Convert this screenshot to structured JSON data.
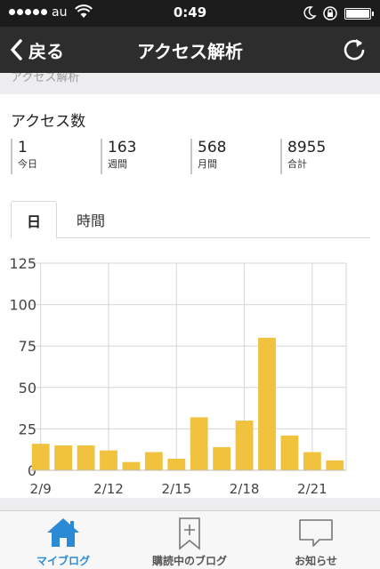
{
  "status_bar": {
    "carrier": "au",
    "time": "0:49"
  },
  "nav": {
    "back_label": "戻る",
    "title": "アクセス解析"
  },
  "section_label": "アクセス解析",
  "access": {
    "title": "アクセス数",
    "stats": [
      {
        "value": "1",
        "label": "今日"
      },
      {
        "value": "163",
        "label": "週間"
      },
      {
        "value": "568",
        "label": "月間"
      },
      {
        "value": "8955",
        "label": "合計"
      }
    ]
  },
  "tabs": [
    {
      "label": "日",
      "active": true
    },
    {
      "label": "時間",
      "active": false
    }
  ],
  "chart_data": {
    "type": "bar",
    "categories": [
      "2/9",
      "2/10",
      "2/11",
      "2/12",
      "2/13",
      "2/14",
      "2/15",
      "2/16",
      "2/17",
      "2/18",
      "2/19",
      "2/20",
      "2/21",
      "2/22"
    ],
    "values": [
      16,
      15,
      15,
      12,
      5,
      11,
      7,
      32,
      14,
      30,
      80,
      21,
      11,
      6
    ],
    "x_tick_labels": [
      "2/9",
      "2/12",
      "2/15",
      "2/18",
      "2/21"
    ],
    "y_tick_labels": [
      "0",
      "25",
      "50",
      "75",
      "100",
      "125"
    ],
    "ylim": [
      0,
      125
    ],
    "bar_color": "#f0c23e",
    "grid": true
  },
  "tab_bar": {
    "items": [
      {
        "label": "マイブログ",
        "icon": "home-icon",
        "active": true
      },
      {
        "label": "購読中のブログ",
        "icon": "bookmark-icon",
        "active": false
      },
      {
        "label": "お知らせ",
        "icon": "speech-bubble-icon",
        "active": false
      }
    ]
  },
  "colors": {
    "accent": "#2b8ad6",
    "nav_bg": "#2d2d2d"
  }
}
